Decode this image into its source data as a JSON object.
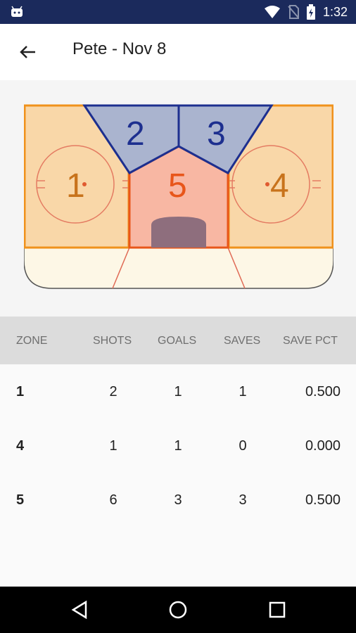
{
  "status": {
    "time": "1:32"
  },
  "header": {
    "title": "Pete - Nov 8"
  },
  "rink": {
    "zones": [
      "1",
      "2",
      "3",
      "4",
      "5"
    ]
  },
  "table": {
    "columns": [
      "ZONE",
      "SHOTS",
      "GOALS",
      "SAVES",
      "SAVE PCT"
    ],
    "rows": [
      {
        "zone": "1",
        "shots": "2",
        "goals": "1",
        "saves": "1",
        "pct": "0.500"
      },
      {
        "zone": "4",
        "shots": "1",
        "goals": "1",
        "saves": "0",
        "pct": "0.000"
      },
      {
        "zone": "5",
        "shots": "6",
        "goals": "3",
        "saves": "3",
        "pct": "0.500"
      }
    ]
  },
  "colors": {
    "status_bar": "#1b2a5c",
    "zone_orange_fill": "#f9d7a8",
    "zone_blue_fill": "#aab4cf",
    "zone_red_fill": "#f8b7a3"
  },
  "icons": [
    "android-icon",
    "wifi-icon",
    "no-sim-icon",
    "battery-icon",
    "back-arrow-icon",
    "nav-back-icon",
    "nav-home-icon",
    "nav-recents-icon"
  ]
}
